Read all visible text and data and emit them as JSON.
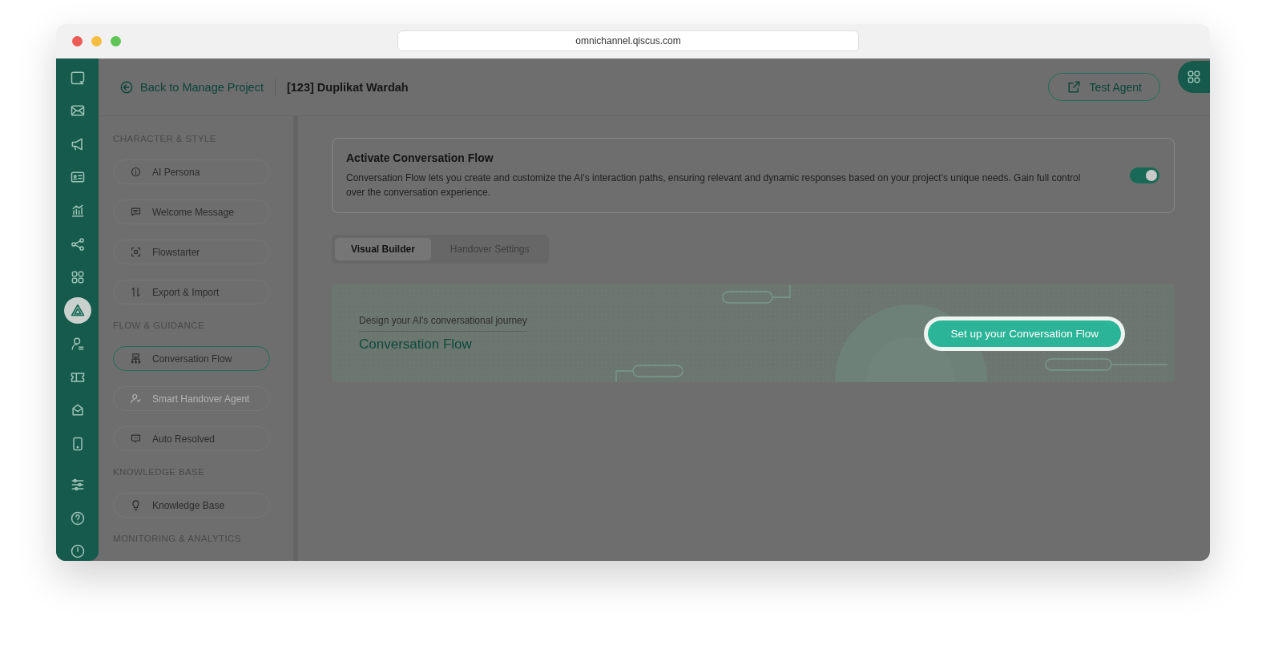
{
  "browser": {
    "url": "omnichannel.qiscus.com"
  },
  "rail": {
    "items": [
      {
        "selected": false
      },
      {
        "selected": false
      },
      {
        "selected": false
      },
      {
        "selected": false
      },
      {
        "selected": false
      },
      {
        "selected": false
      },
      {
        "selected": false
      },
      {
        "selected": true
      },
      {
        "selected": false
      },
      {
        "selected": false
      },
      {
        "selected": false
      },
      {
        "selected": false
      },
      {
        "selected": false
      },
      {
        "selected": false
      },
      {
        "selected": false
      }
    ]
  },
  "header": {
    "back_link": "Back to Manage Project",
    "project_title": "[123] Duplikat Wardah",
    "test_agent_button": "Test Agent"
  },
  "sidebar": {
    "sections": [
      {
        "title": "CHARACTER & STYLE",
        "items": [
          {
            "label": "AI Persona",
            "selected": false,
            "disabled": false
          },
          {
            "label": "Welcome Message",
            "selected": false,
            "disabled": false
          },
          {
            "label": "Flowstarter",
            "selected": false,
            "disabled": false
          },
          {
            "label": "Export & Import",
            "selected": false,
            "disabled": false
          }
        ]
      },
      {
        "title": "FLOW & GUIDANCE",
        "items": [
          {
            "label": "Conversation Flow",
            "selected": true,
            "disabled": false
          },
          {
            "label": "Smart Handover Agent",
            "selected": false,
            "disabled": true
          },
          {
            "label": "Auto Resolved",
            "selected": false,
            "disabled": false
          }
        ]
      },
      {
        "title": "KNOWLEDGE BASE",
        "items": [
          {
            "label": "Knowledge Base",
            "selected": false,
            "disabled": false
          }
        ]
      },
      {
        "title": "MONITORING & ANALYTICS"
      }
    ]
  },
  "activation_card": {
    "title": "Activate Conversation Flow",
    "description": "Conversation Flow lets you create and customize the AI's interaction paths, ensuring relevant and dynamic responses based on your project's unique needs. Gain full control over the conversation experience.",
    "on": true
  },
  "tabs": [
    {
      "label": "Visual Builder",
      "selected": true
    },
    {
      "label": "Handover Settings",
      "selected": false
    }
  ],
  "banner": {
    "subtitle": "Design your AI's conversational journey",
    "title": "Conversation Flow",
    "button": "Set up your Conversation Flow"
  }
}
